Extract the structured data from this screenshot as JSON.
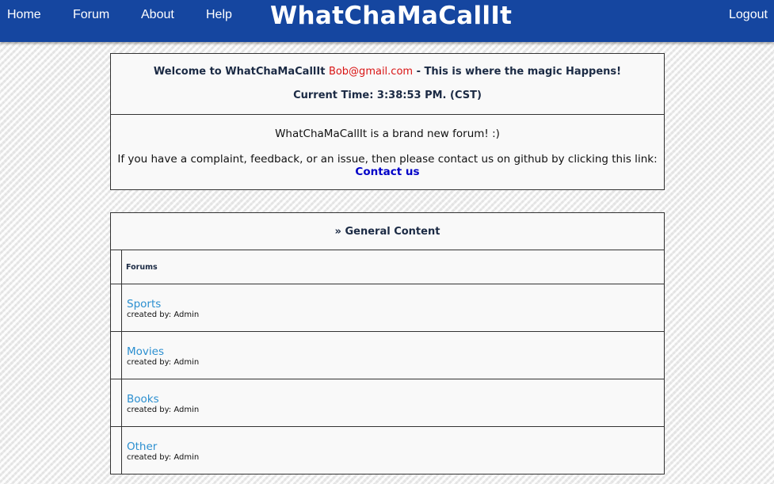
{
  "nav": {
    "home": "Home",
    "forum": "Forum",
    "about": "About",
    "help": "Help",
    "logout": "Logout"
  },
  "brand": "WhatChaMaCallIt",
  "welcome": {
    "prefix": "Welcome to WhatChaMaCallIt",
    "email": "Bob@gmail.com",
    "suffix": "- This is where the magic Happens!",
    "time": "Current Time: 3:38:53 PM. (CST)"
  },
  "info": {
    "line1": "WhatChaMaCallIt is a brand new forum! :)",
    "line2": "If you have a complaint, feedback, or an issue, then please contact us on github by clicking this link:",
    "contact_label": "Contact us"
  },
  "general": {
    "title": "» General Content",
    "forums_header": "Forums",
    "forums": [
      {
        "name": "Sports",
        "creator": "created by: Admin"
      },
      {
        "name": "Movies",
        "creator": "created by: Admin"
      },
      {
        "name": "Books",
        "creator": "created by: Admin"
      },
      {
        "name": "Other",
        "creator": "created by: Admin"
      }
    ]
  },
  "colors": {
    "topbar": "#1546a0",
    "email": "#d91414",
    "contact_link": "#0000c8",
    "forum_link": "#2b8fd0"
  }
}
